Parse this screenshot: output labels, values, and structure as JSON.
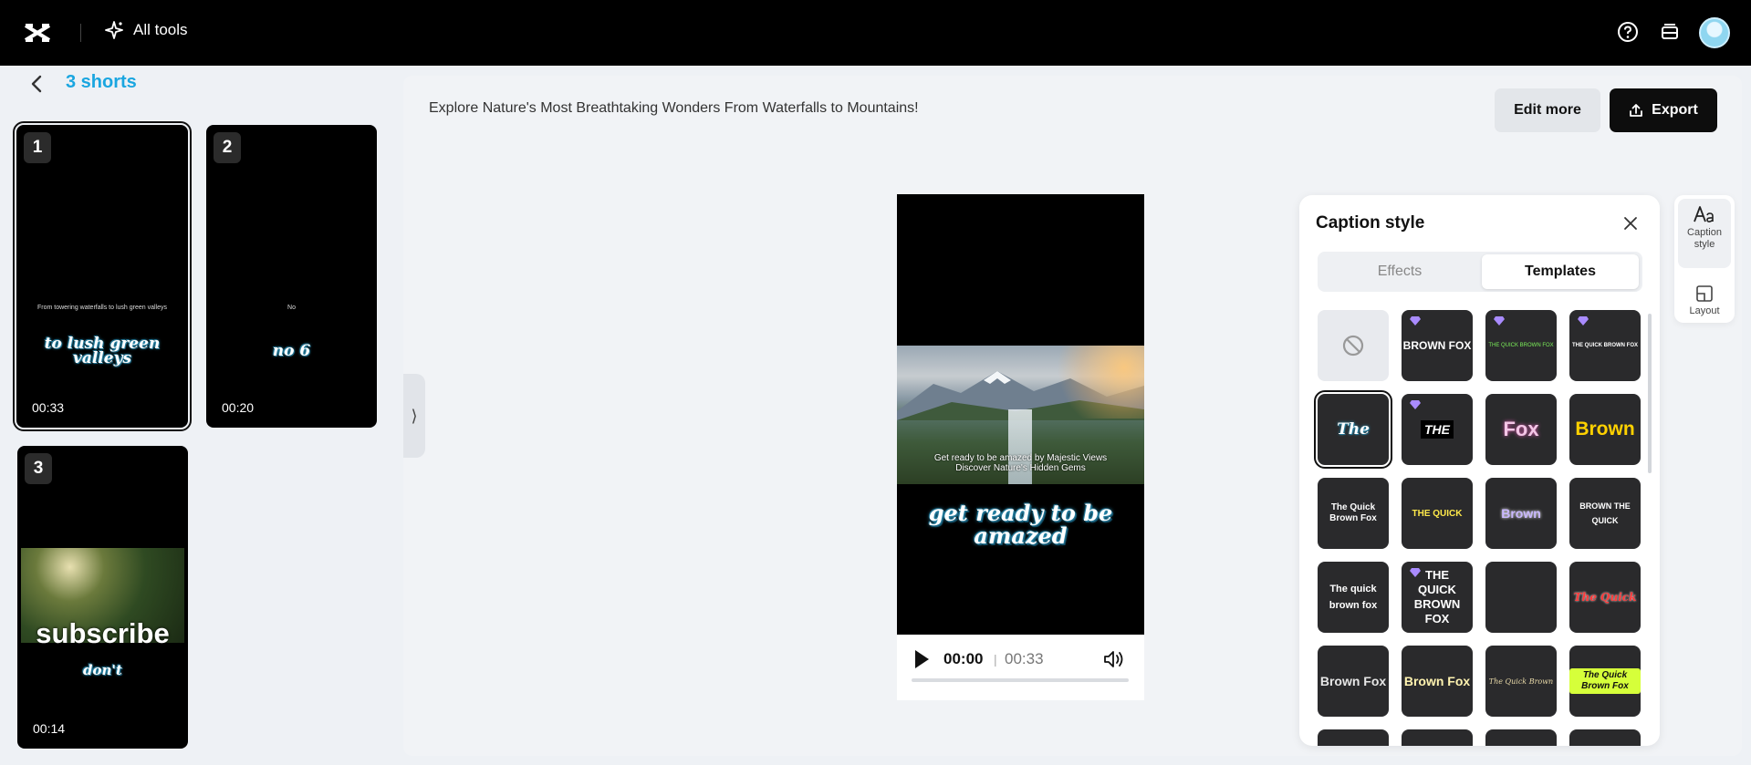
{
  "topbar": {
    "all_tools_label": "All tools",
    "icons": [
      "capcut-logo-icon",
      "sparkle-icon",
      "help-icon",
      "inbox-icon",
      "avatar"
    ]
  },
  "left": {
    "title": "3 shorts",
    "cards": [
      {
        "num": "1",
        "small": "From towering waterfalls to lush green valleys",
        "big": "to lush green valleys",
        "duration": "00:33"
      },
      {
        "num": "2",
        "small": "No",
        "big": "no 6",
        "duration": "00:20"
      },
      {
        "num": "3",
        "small": "",
        "big": "subscribe",
        "big2": "don't",
        "duration": "00:14"
      }
    ]
  },
  "main": {
    "project_title": "Explore Nature's Most Breathtaking Wonders From Waterfalls to Mountains!",
    "edit_more_label": "Edit more",
    "export_label": "Export"
  },
  "player": {
    "subtitle_line1": "Get ready to be amazed by Majestic Views",
    "subtitle_line2": "Discover Nature's Hidden Gems",
    "caption": "get ready to be amazed",
    "current_time": "00:00",
    "separator": "|",
    "total_time": "00:33",
    "progress": 0
  },
  "caption_panel": {
    "title": "Caption style",
    "tabs": {
      "effects": "Effects",
      "templates": "Templates"
    },
    "templates": [
      {
        "label": "",
        "kind": "none"
      },
      {
        "label": "BROWN FOX",
        "kind": "premium"
      },
      {
        "label": "THE QUICK BROWN FOX",
        "kind": "premium"
      },
      {
        "label": "THE QUICK BROWN FOX",
        "kind": "premium"
      },
      {
        "label": "The",
        "kind": "selected"
      },
      {
        "label": "THE",
        "kind": "premium"
      },
      {
        "label": "Fox",
        "kind": "plain"
      },
      {
        "label": "Brown",
        "kind": "plain"
      },
      {
        "label": "The Quick Brown Fox",
        "kind": "plain"
      },
      {
        "label": "THE QUICK",
        "kind": "plain"
      },
      {
        "label": "Brown",
        "kind": "plain"
      },
      {
        "label": "BROWN THE QUICK",
        "kind": "plain"
      },
      {
        "label": "The quick brown fox",
        "kind": "plain"
      },
      {
        "label": "THE QUICK BROWN FOX",
        "kind": "premium"
      },
      {
        "label": "",
        "kind": "plain"
      },
      {
        "label": "The Quick",
        "kind": "plain"
      },
      {
        "label": "Brown Fox",
        "kind": "plain"
      },
      {
        "label": "Brown Fox",
        "kind": "plain"
      },
      {
        "label": "The Quick Brown",
        "kind": "plain"
      },
      {
        "label": "The Quick Brown Fox",
        "kind": "plain"
      }
    ]
  },
  "rail": {
    "caption_style_label": "Caption style",
    "layout_label": "Layout"
  },
  "colors": {
    "accent": "#1aa6e0",
    "premium": "#9b6cff"
  }
}
